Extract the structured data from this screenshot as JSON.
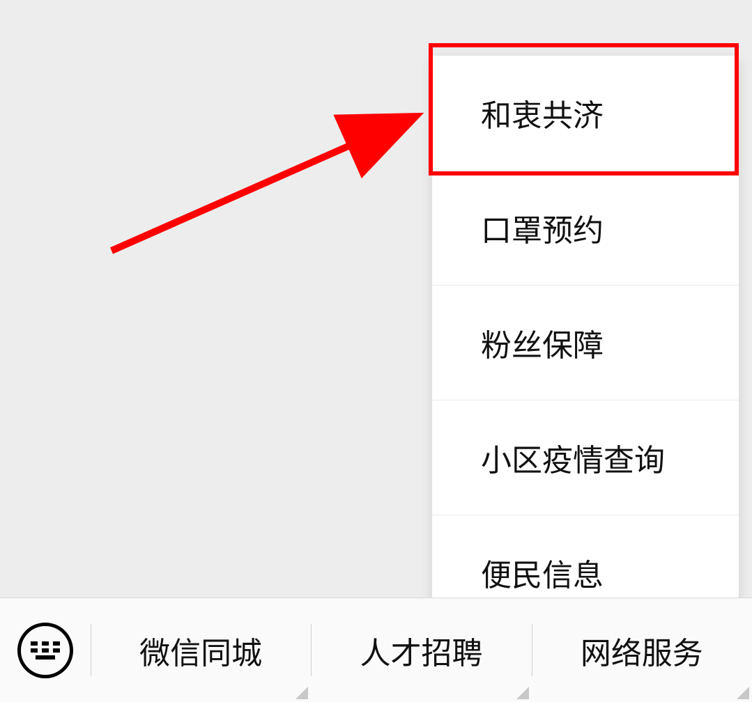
{
  "popup_items": [
    "和衷共济",
    "口罩预约",
    "粉丝保障",
    "小区疫情查询",
    "便民信息"
  ],
  "bottom_menu": {
    "items": [
      "微信同城",
      "人才招聘",
      "网络服务"
    ]
  },
  "highlight_index": 0,
  "annotation": {
    "color": "#ff0000"
  }
}
